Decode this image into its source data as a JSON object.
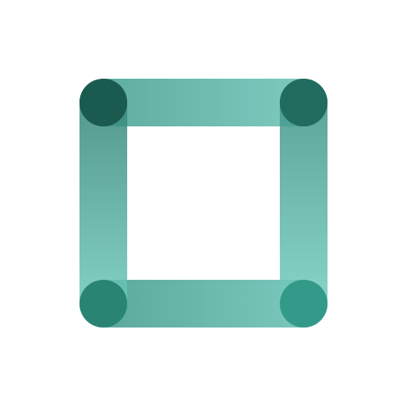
{
  "icon": {
    "name": "square-outline-logo-icon"
  },
  "colors": {
    "background": "#ffffff",
    "bar_light": "#63c0b3",
    "bar_mid": "#4fa99b",
    "bar_dark": "#1f6b5e",
    "corner_darkest": "#1d5a4f",
    "corner_bottom": "#2b8a7a"
  }
}
